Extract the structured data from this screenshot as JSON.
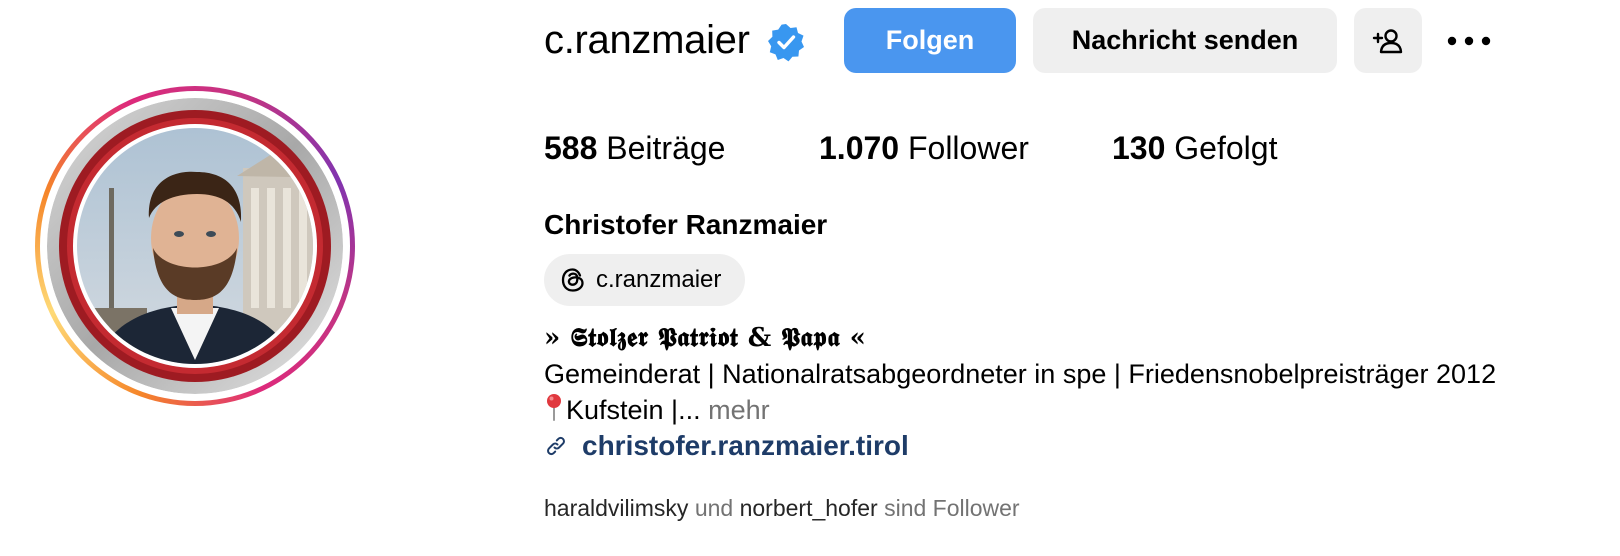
{
  "profile": {
    "username": "c.ranzmaier",
    "verified_icon": "verified-badge-icon",
    "full_name": "Christofer Ranzmaier"
  },
  "actions": {
    "follow_label": "Folgen",
    "message_label": "Nachricht senden",
    "suggest_icon": "add-person-icon",
    "more_icon": "more-options-icon"
  },
  "stats": {
    "posts_count": "588",
    "posts_label": "Beiträge",
    "followers_count": "1.070",
    "followers_label": "Follower",
    "following_count": "130",
    "following_label": "Gefolgt"
  },
  "threads": {
    "icon": "threads-icon",
    "handle": "c.ranzmaier"
  },
  "bio": {
    "line1": "» 𝕾𝖙𝖔𝖑𝖟𝖊𝖗 𝕻𝖆𝖙𝖗𝖎𝖔𝖙 & 𝕻𝖆𝖕𝖆 «",
    "line2": "Gemeinderat | Nationalratsabgeordneter in spe | Friedensnobelpreisträger 2012",
    "line3": "Kufstein |...",
    "pin_icon": "round-pushpin-icon",
    "more_label": "mehr"
  },
  "website": {
    "icon": "link-icon",
    "url": "christofer.ranzmaier.tirol"
  },
  "followed_by": {
    "user1": "haraldvilimsky",
    "connector": "und",
    "user2": "norbert_hofer",
    "suffix": "sind Follower"
  },
  "colors": {
    "follow_button": "#4a96ef",
    "secondary_button": "#efefef",
    "verified_badge": "#3897f0",
    "link": "#1e3c68",
    "muted_text": "#737373"
  }
}
